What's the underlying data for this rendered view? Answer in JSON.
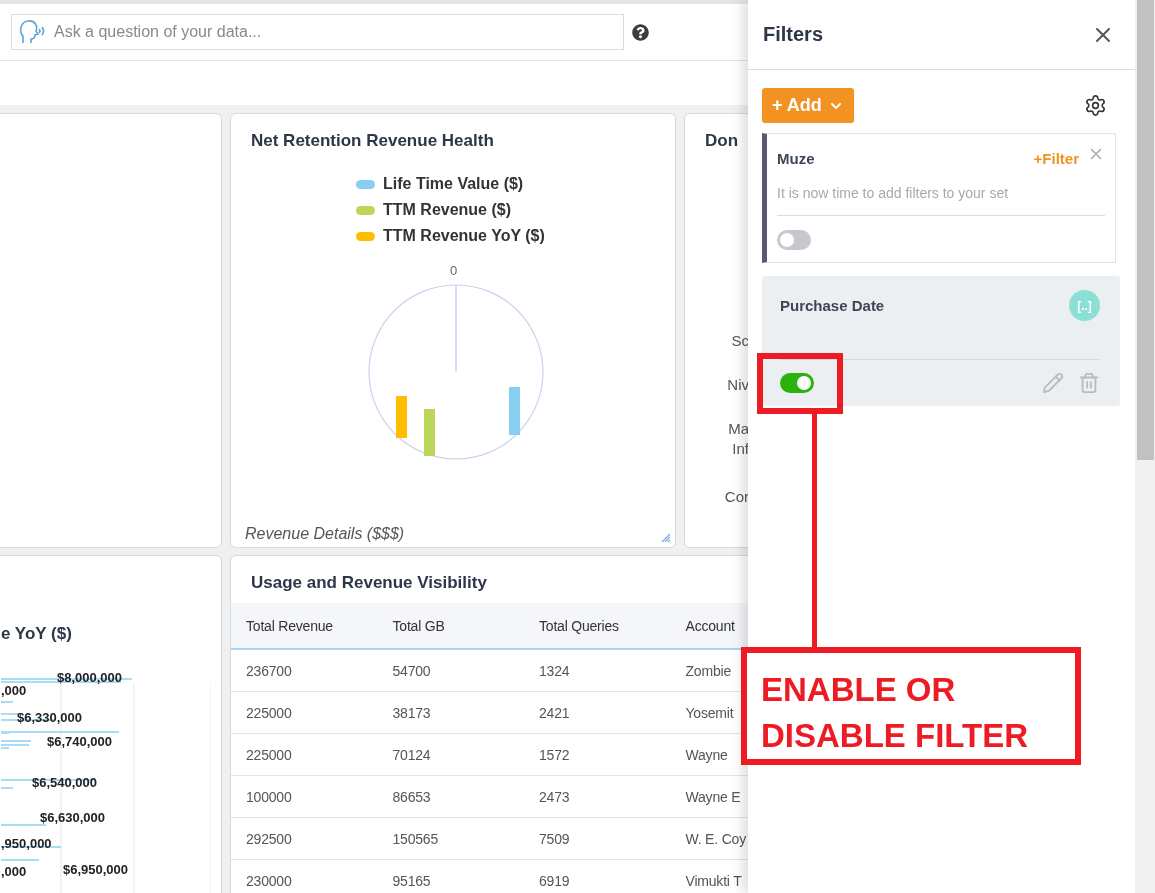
{
  "search": {
    "placeholder": "Ask a question of your data..."
  },
  "yoy_card": {
    "title": "e YoY ($)",
    "bar_labels": [
      "$8,000,000",
      ",000",
      "$6,330,000",
      "$6,740,000",
      "$6,540,000",
      "$6,630,000",
      ",950,000",
      ",000",
      "$6,950,000"
    ]
  },
  "retention_card": {
    "title": "Net Retention Revenue Health",
    "legend": [
      {
        "label": "Life Time Value ($)",
        "color": "#87cef0"
      },
      {
        "label": "TTM Revenue ($)",
        "color": "#bcd65a"
      },
      {
        "label": "TTM Revenue YoY ($)",
        "color": "#ffbd00"
      }
    ],
    "axis_label": "0",
    "footer": "Revenue Details ($$$)"
  },
  "don_card": {
    "title": "Don",
    "labels": [
      "Sc",
      "Niv",
      "Ma",
      "Inf",
      "Cor"
    ]
  },
  "usage_card": {
    "title": "Usage and Revenue Visibility",
    "columns": [
      "Total Revenue",
      "Total GB",
      "Total Queries",
      "Account"
    ],
    "rows": [
      [
        "236700",
        "54700",
        "1324",
        "Zombie"
      ],
      [
        "225000",
        "38173",
        "2421",
        "Yosemit"
      ],
      [
        "225000",
        "70124",
        "1572",
        "Wayne"
      ],
      [
        "100000",
        "86653",
        "2473",
        "Wayne E"
      ],
      [
        "292500",
        "150565",
        "7509",
        "W. E. Coy"
      ],
      [
        "230000",
        "95165",
        "6919",
        "Vimukti T"
      ]
    ]
  },
  "filters": {
    "title": "Filters",
    "add_label": "+ Add",
    "sets": [
      {
        "kind": "set",
        "name": "Muze",
        "action": "+Filter",
        "hint": "It is now time to add filters to your set",
        "on": false
      },
      {
        "kind": "filter",
        "name": "Purchase Date",
        "badge": "[..]",
        "on": true
      }
    ]
  },
  "annotation": {
    "text": "ENABLE OR DISABLE FILTER"
  }
}
